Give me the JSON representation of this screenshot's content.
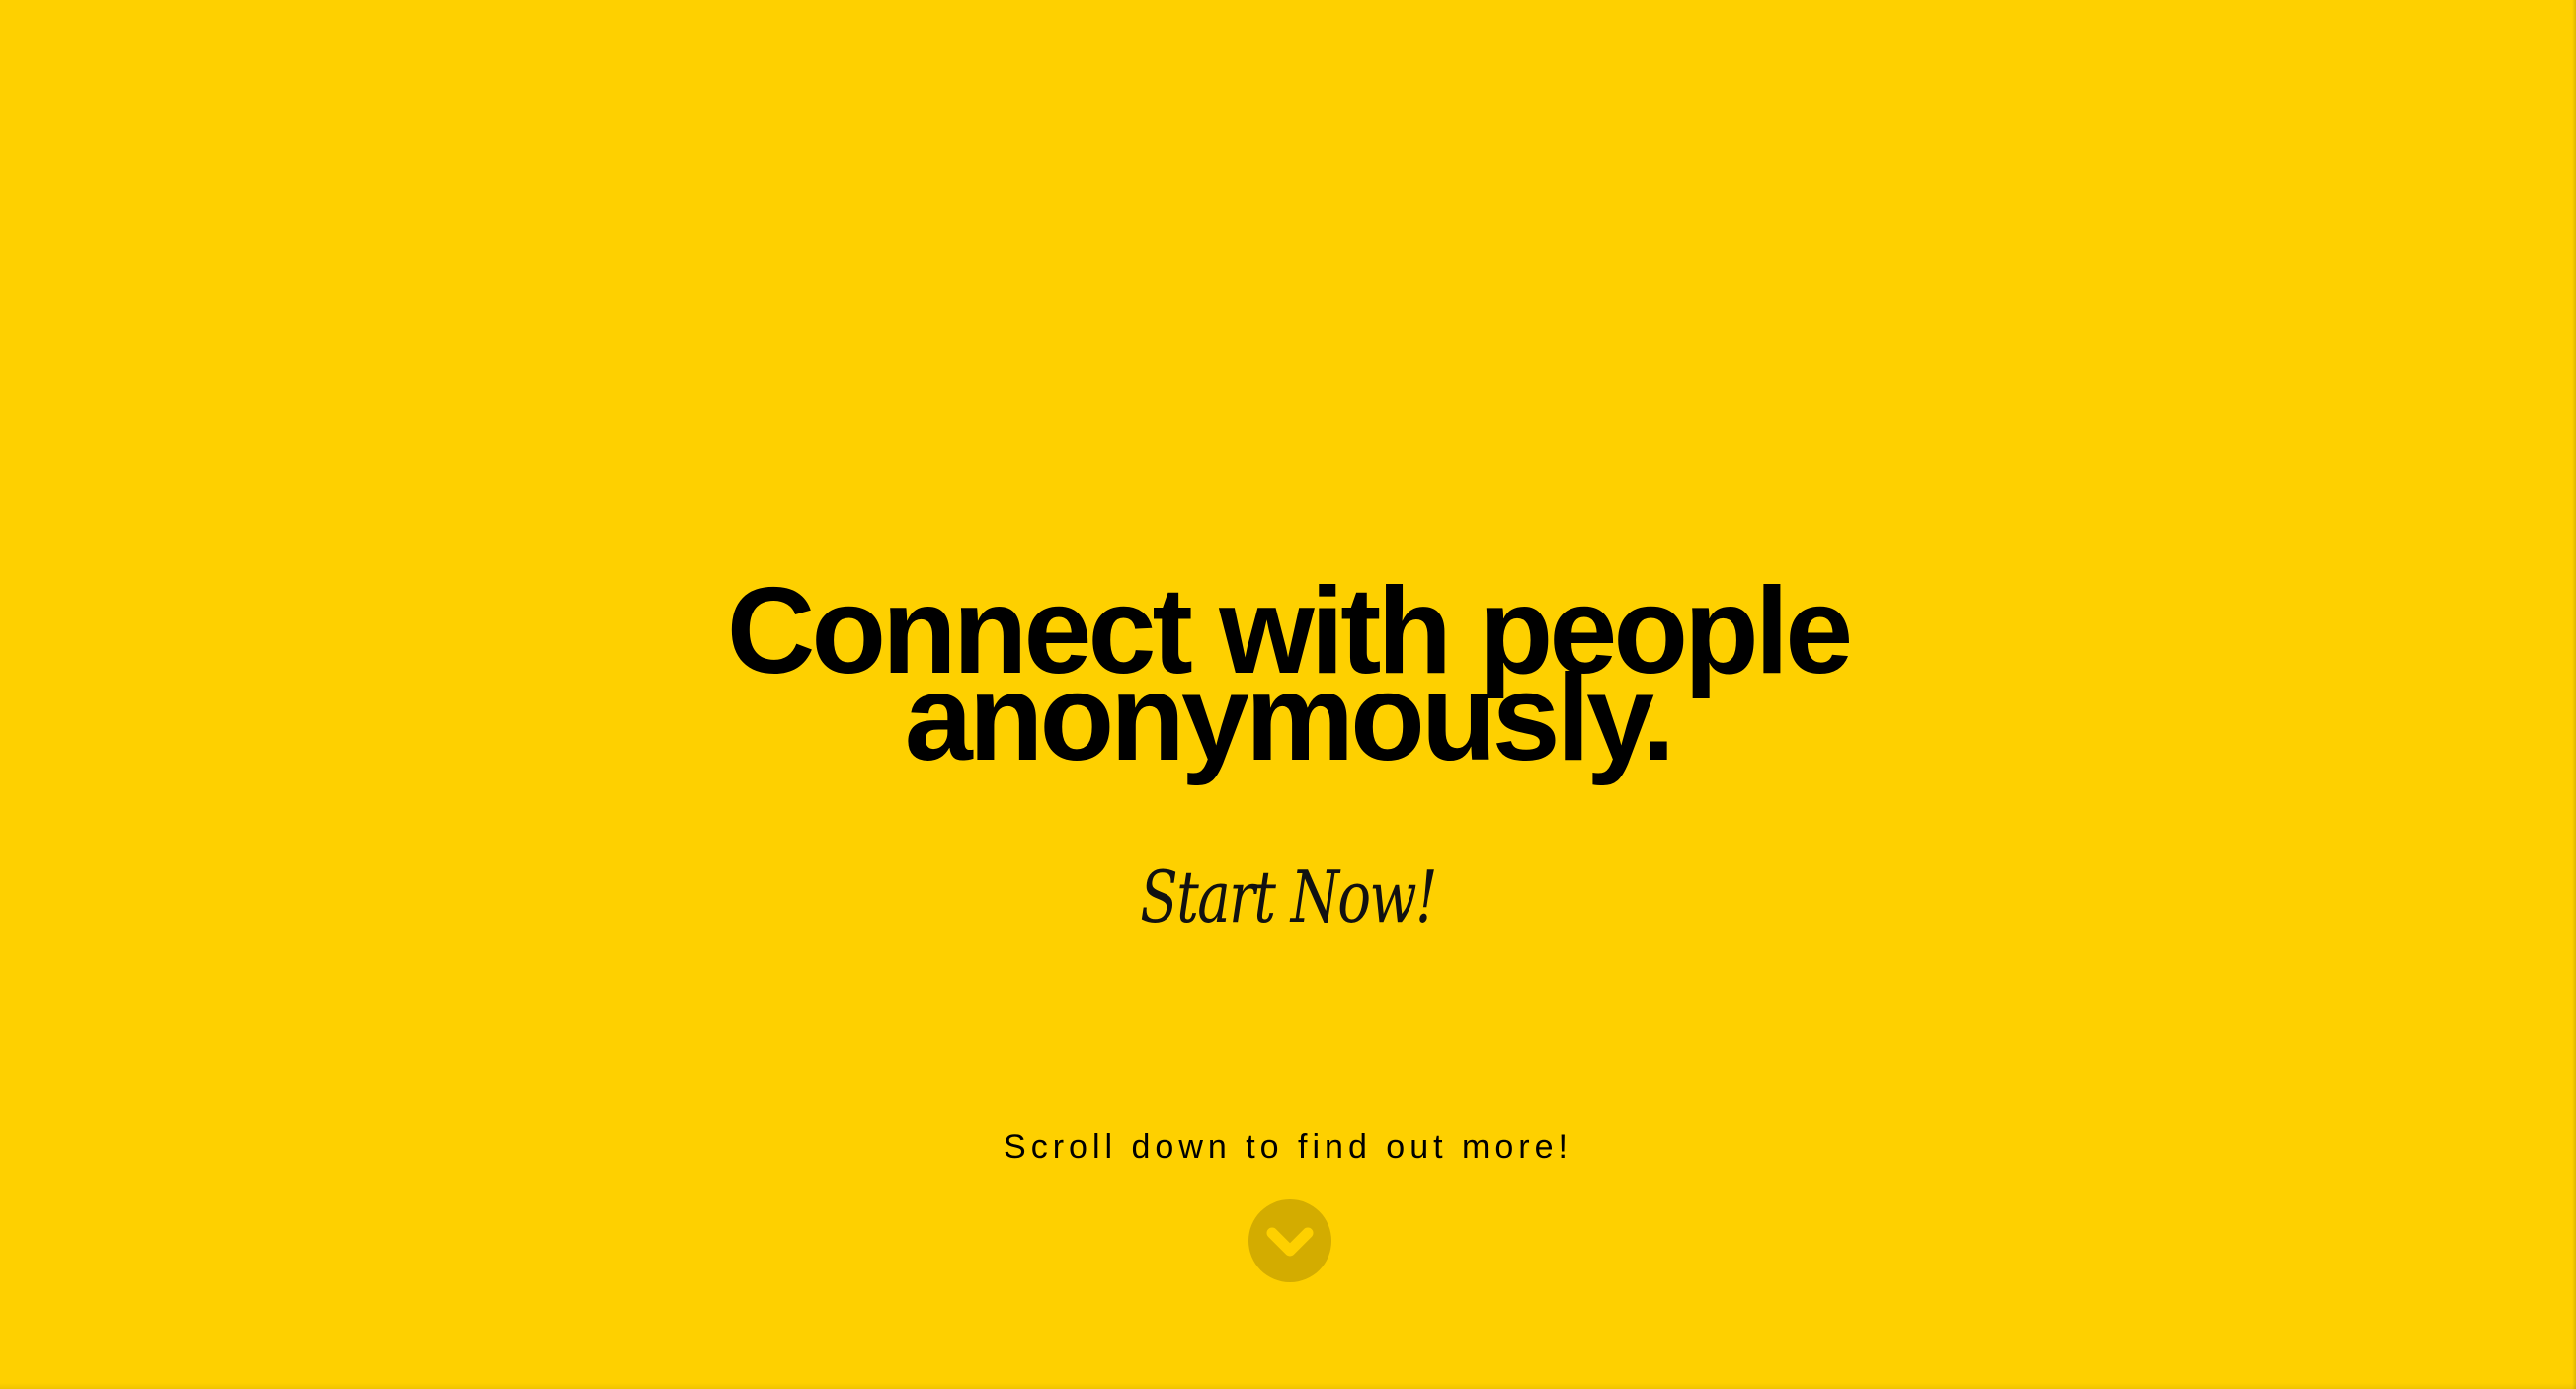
{
  "hero": {
    "headline_line1": "Connect with people",
    "headline_line2": "anonymously."
  },
  "cta": {
    "label": "Start Now!"
  },
  "scroll": {
    "text": "Scroll down to find out more!",
    "icon": "chevron-down-icon"
  },
  "colors": {
    "background": "#FED000",
    "text": "#000000",
    "scroll_button": "#D3AC00",
    "chevron": "#FED000"
  }
}
